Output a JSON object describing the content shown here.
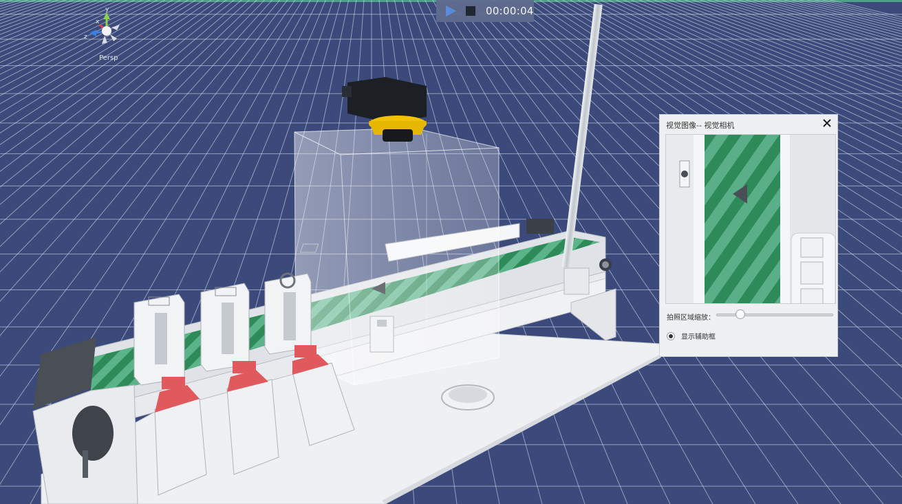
{
  "viewport": {
    "camera_mode": "Persp",
    "gizmo_axes": {
      "x": "x",
      "y": "y",
      "z": "z"
    }
  },
  "playback": {
    "play_icon": "play-icon",
    "stop_icon": "stop-icon",
    "elapsed_time": "00:00:04"
  },
  "vision_panel": {
    "title": "视觉图像-- 视觉相机",
    "close_icon": "close-icon",
    "zoom_label": "拍照区域缩放：",
    "zoom_level": 0.18,
    "show_aux_frame_label": "显示辅助框",
    "show_aux_frame_selected": true
  },
  "colors": {
    "background": "#3b4a7a",
    "grid_line": "#dfe5f2",
    "belt_green": "#3f9468",
    "pusher_red": "#e0595c",
    "camera_yellow": "#f2c200",
    "accent_top": "#4fa08a"
  }
}
